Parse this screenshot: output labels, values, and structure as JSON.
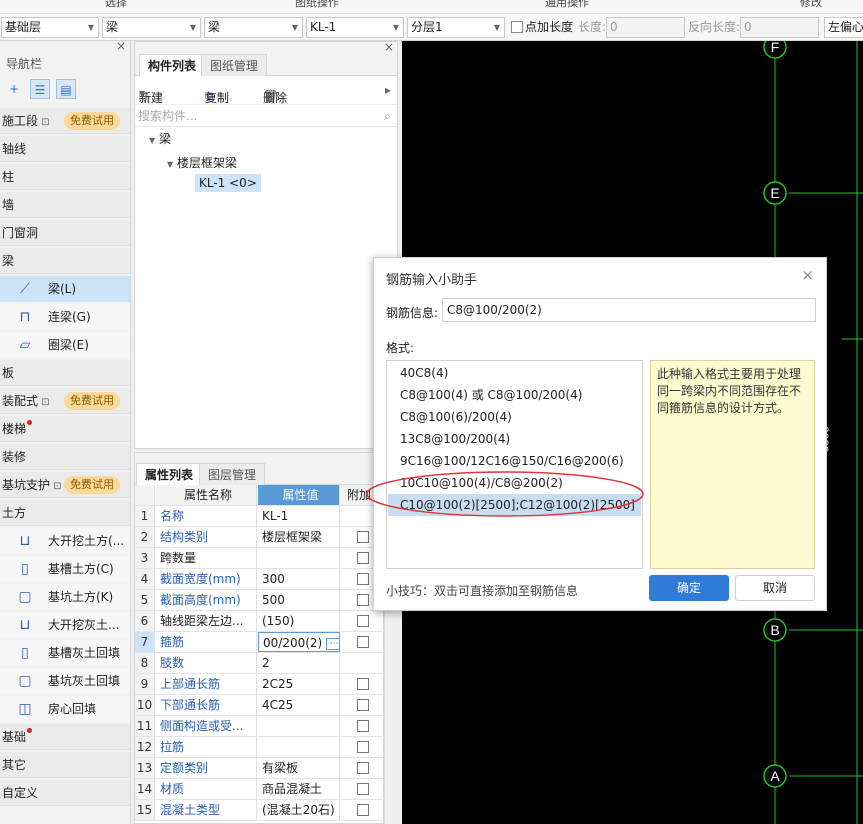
{
  "top_menu": [
    "选择",
    "图纸操作",
    "通用操作",
    "修改"
  ],
  "toolbar": {
    "layer_select": "基础层",
    "type_select": "梁",
    "subtype_select": "梁",
    "component_select": "KL-1",
    "floor_select": "分层1",
    "add_length_label": "点加长度",
    "length_label": "长度:",
    "length_value": "0",
    "reverse_length_label": "反向长度:",
    "reverse_length_value": "0",
    "offset_select": "左偏心"
  },
  "nav": {
    "title": "导航栏",
    "close": "×",
    "free_badge": "免费试用",
    "items": [
      {
        "label": "施工段",
        "lock": true,
        "badge": true
      },
      {
        "label": "轴线"
      },
      {
        "label": "柱"
      },
      {
        "label": "墙"
      },
      {
        "label": "门窗洞"
      },
      {
        "label": "梁"
      },
      {
        "label": "梁(L)",
        "sub": true,
        "selected": true,
        "icon": "beam-icon"
      },
      {
        "label": "连梁(G)",
        "sub": true,
        "icon": "link-beam-icon"
      },
      {
        "label": "圈梁(E)",
        "sub": true,
        "icon": "ring-beam-icon"
      },
      {
        "label": "板"
      },
      {
        "label": "装配式",
        "lock": true,
        "badge": true
      },
      {
        "label": "楼梯",
        "dot": true
      },
      {
        "label": "装修"
      },
      {
        "label": "基坑支护",
        "lock": true,
        "badge": true
      },
      {
        "label": "土方"
      },
      {
        "label": "大开挖土方(...",
        "sub": true,
        "icon": "excavation-icon"
      },
      {
        "label": "基槽土方(C)",
        "sub": true,
        "icon": "trench-icon"
      },
      {
        "label": "基坑土方(K)",
        "sub": true,
        "icon": "pit-icon"
      },
      {
        "label": "大开挖灰土...",
        "sub": true,
        "icon": "lime-excavation-icon"
      },
      {
        "label": "基槽灰土回填",
        "sub": true,
        "icon": "trench-backfill-icon"
      },
      {
        "label": "基坑灰土回填",
        "sub": true,
        "icon": "pit-backfill-icon"
      },
      {
        "label": "房心回填",
        "sub": true,
        "icon": "room-backfill-icon"
      },
      {
        "label": "基础",
        "dot": true
      },
      {
        "label": "其它"
      },
      {
        "label": "自定义"
      }
    ]
  },
  "component_panel": {
    "tabs": [
      "构件列表",
      "图纸管理"
    ],
    "new_label": "新建",
    "copy_label": "复制",
    "delete_label": "删除",
    "search_placeholder": "搜索构件...",
    "tree": {
      "root": "梁",
      "child": "楼层框架梁",
      "leaf": "KL-1 <0>"
    }
  },
  "property_panel": {
    "tabs": [
      "属性列表",
      "图层管理"
    ],
    "headers": {
      "name": "属性名称",
      "value": "属性值",
      "extra": "附加"
    },
    "rows": [
      {
        "no": "1",
        "name": "名称",
        "value": "KL-1",
        "blue": true,
        "check": false
      },
      {
        "no": "2",
        "name": "结构类别",
        "value": "楼层框架梁",
        "blue": true,
        "check": true
      },
      {
        "no": "3",
        "name": "跨数量",
        "value": "",
        "blue": false,
        "check": true
      },
      {
        "no": "4",
        "name": "截面宽度(mm)",
        "value": "300",
        "blue": true,
        "check": true
      },
      {
        "no": "5",
        "name": "截面高度(mm)",
        "value": "500",
        "blue": true,
        "check": true
      },
      {
        "no": "6",
        "name": "轴线距梁左边...",
        "value": "(150)",
        "blue": false,
        "check": true
      },
      {
        "no": "7",
        "name": "箍筋",
        "value": "00/200(2)",
        "blue": true,
        "check": true,
        "selected": true
      },
      {
        "no": "8",
        "name": "肢数",
        "value": "2",
        "blue": true,
        "check": false
      },
      {
        "no": "9",
        "name": "上部通长筋",
        "value": "2C25",
        "blue": true,
        "check": true
      },
      {
        "no": "10",
        "name": "下部通长筋",
        "value": "4C25",
        "blue": true,
        "check": true
      },
      {
        "no": "11",
        "name": "侧面构造或受...",
        "value": "",
        "blue": true,
        "check": true
      },
      {
        "no": "12",
        "name": "拉筋",
        "value": "",
        "blue": true,
        "check": true
      },
      {
        "no": "13",
        "name": "定额类别",
        "value": "有梁板",
        "blue": true,
        "check": true
      },
      {
        "no": "14",
        "name": "材质",
        "value": "商品混凝土",
        "blue": true,
        "check": true
      },
      {
        "no": "15",
        "name": "混凝土类型",
        "value": "(混凝土20石)",
        "blue": true,
        "check": true
      }
    ]
  },
  "canvas": {
    "axes": [
      "F",
      "E",
      "B",
      "A"
    ],
    "side_text": "2000"
  },
  "dialog": {
    "title": "钢筋输入小助手",
    "close": "×",
    "rebar_label": "钢筋信息:",
    "rebar_value": "C8@100/200(2)",
    "format_label": "格式:",
    "formats": [
      "40C8(4)",
      "C8@100(4) 或 C8@100/200(4)",
      "C8@100(6)/200(4)",
      "13C8@100/200(4)",
      "9C16@100/12C16@150/C16@200(6)",
      "10C10@100(4)/C8@200(2)",
      "C10@100(2)[2500];C12@100(2)[2500]"
    ],
    "selected_format": 6,
    "hint": "此种输入格式主要用于处理同一跨梁内不同范围存在不同箍筋信息的设计方式。",
    "tip": "小技巧：双击可直接添加至钢筋信息",
    "ok_label": "确定",
    "cancel_label": "取消",
    "highlight_color": "#e0353a"
  }
}
